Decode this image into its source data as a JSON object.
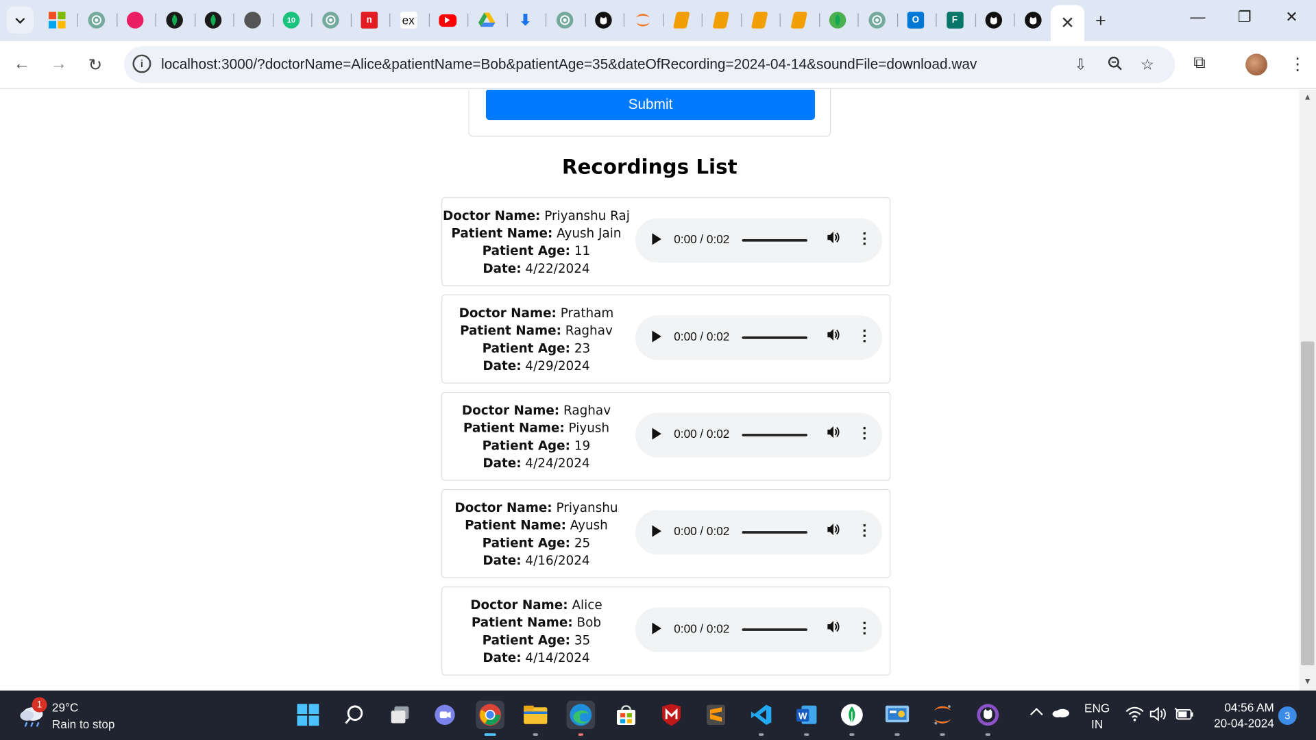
{
  "browser": {
    "tabs": [
      {
        "icon": "chevron-down-icon"
      },
      {
        "icon": "windows-store-icon",
        "color": "#f25022"
      },
      {
        "icon": "chatgpt-icon",
        "color": "#74aa9c"
      },
      {
        "icon": "app-icon",
        "color": "#e91e63"
      },
      {
        "icon": "leaf-icon",
        "color": "#1a1a1a"
      },
      {
        "icon": "leaf-icon",
        "color": "#1a1a1a"
      },
      {
        "icon": "globe-icon",
        "color": "#555"
      },
      {
        "icon": "ten-icon",
        "label": "10",
        "color": "#19c37d"
      },
      {
        "icon": "chatgpt-icon",
        "color": "#74aa9c"
      },
      {
        "icon": "n-icon",
        "label": "n",
        "color": "#e31b23"
      },
      {
        "icon": "ex-icon",
        "label": "ex",
        "color": "#fff"
      },
      {
        "icon": "youtube-icon",
        "color": "#ff0000"
      },
      {
        "icon": "drive-icon",
        "color": "#34a853"
      },
      {
        "icon": "download-icon",
        "color": "#1a73e8"
      },
      {
        "icon": "chatgpt-icon",
        "color": "#74aa9c"
      },
      {
        "icon": "github-icon",
        "color": "#111"
      },
      {
        "icon": "jupyter-icon",
        "color": "#f37626"
      },
      {
        "icon": "book-icon",
        "color": "#f29f05"
      },
      {
        "icon": "book-icon",
        "color": "#f29f05"
      },
      {
        "icon": "book-icon",
        "color": "#f29f05"
      },
      {
        "icon": "book-icon",
        "color": "#f29f05"
      },
      {
        "icon": "leaf-icon",
        "color": "#4caf50"
      },
      {
        "icon": "chatgpt-icon",
        "color": "#74aa9c"
      },
      {
        "icon": "outlook-icon",
        "color": "#0078d4"
      },
      {
        "icon": "forms-icon",
        "color": "#077568"
      },
      {
        "icon": "github-icon",
        "color": "#111"
      },
      {
        "icon": "github-icon",
        "color": "#111"
      }
    ],
    "active_tab_close": "✕",
    "new_tab": "+",
    "url": "localhost:3000/?doctorName=Alice&patientName=Bob&patientAge=35&dateOfRecording=2024-04-14&soundFile=download.wav"
  },
  "page": {
    "submit_label": "Submit",
    "list_title": "Recordings List",
    "labels": {
      "doctor": "Doctor Name:",
      "patient": "Patient Name:",
      "age": "Patient Age:",
      "date": "Date:"
    },
    "recordings": [
      {
        "doctor": "Priyanshu Raj",
        "patient": "Ayush Jain",
        "age": "11",
        "date": "4/22/2024",
        "time": "0:00 / 0:02"
      },
      {
        "doctor": "Pratham",
        "patient": "Raghav",
        "age": "23",
        "date": "4/29/2024",
        "time": "0:00 / 0:02"
      },
      {
        "doctor": "Raghav",
        "patient": "Piyush",
        "age": "19",
        "date": "4/24/2024",
        "time": "0:00 / 0:02"
      },
      {
        "doctor": "Priyanshu",
        "patient": "Ayush",
        "age": "25",
        "date": "4/16/2024",
        "time": "0:00 / 0:02"
      },
      {
        "doctor": "Alice",
        "patient": "Bob",
        "age": "35",
        "date": "4/14/2024",
        "time": "0:00 / 0:02"
      }
    ]
  },
  "taskbar": {
    "weather_badge": "1",
    "temperature": "29°C",
    "weather_text": "Rain to stop",
    "lang_top": "ENG",
    "lang_bottom": "IN",
    "time": "04:56 AM",
    "date": "20-04-2024",
    "notifications": "3"
  },
  "colors": {
    "submit": "#007bff",
    "tabstrip": "#dfe7f4",
    "taskbar": "#1f2430"
  }
}
